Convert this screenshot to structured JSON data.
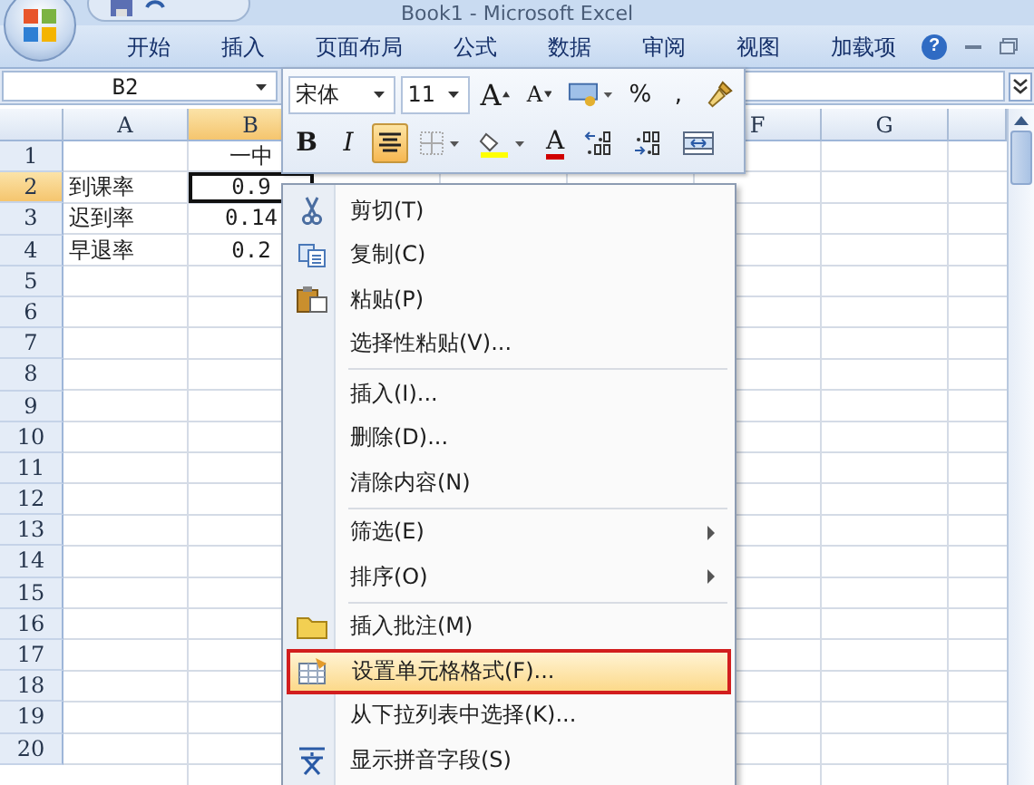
{
  "window": {
    "title": "Book1 - Microsoft Excel"
  },
  "ribbon_tabs": [
    {
      "label": "开始",
      "selected": false
    },
    {
      "label": "插入",
      "selected": false
    },
    {
      "label": "页面布局",
      "selected": false
    },
    {
      "label": "公式",
      "selected": false
    },
    {
      "label": "数据",
      "selected": false
    },
    {
      "label": "审阅",
      "selected": false
    },
    {
      "label": "视图",
      "selected": false
    },
    {
      "label": "加载项",
      "selected": false
    }
  ],
  "help_button": {
    "label": "?"
  },
  "formula_bar": {
    "name_box": "B2"
  },
  "sheet": {
    "columns": {
      "a": {
        "label": "A",
        "selected": false
      },
      "b": {
        "label": "B",
        "selected": true
      },
      "f": {
        "label": "F",
        "selected": false
      },
      "g": {
        "label": "G",
        "selected": false
      }
    },
    "rows": [
      {
        "label": "1",
        "selected": false,
        "cells": {
          "b": {
            "text": "一中",
            "active": false
          }
        }
      },
      {
        "label": "2",
        "selected": true,
        "cells": {
          "a": {
            "text": "到课率",
            "active": false
          },
          "b": {
            "text": "0.9",
            "active": true
          }
        }
      },
      {
        "label": "3",
        "selected": false,
        "cells": {
          "a": {
            "text": "迟到率",
            "active": false
          },
          "b": {
            "text": "0.14",
            "active": false
          }
        }
      },
      {
        "label": "4",
        "selected": false,
        "cells": {
          "a": {
            "text": "早退率",
            "active": false
          },
          "b": {
            "text": "0.2",
            "active": false
          }
        }
      },
      {
        "label": "5",
        "selected": false
      },
      {
        "label": "6",
        "selected": false
      },
      {
        "label": "7",
        "selected": false
      },
      {
        "label": "8",
        "selected": false
      },
      {
        "label": "9",
        "selected": false
      },
      {
        "label": "10",
        "selected": false
      },
      {
        "label": "11",
        "selected": false
      },
      {
        "label": "12",
        "selected": false
      },
      {
        "label": "13",
        "selected": false
      },
      {
        "label": "14",
        "selected": false
      },
      {
        "label": "15",
        "selected": false
      },
      {
        "label": "16",
        "selected": false
      },
      {
        "label": "17",
        "selected": false
      },
      {
        "label": "18",
        "selected": false
      },
      {
        "label": "19",
        "selected": false
      },
      {
        "label": "20",
        "selected": false
      }
    ]
  },
  "mini_toolbar": {
    "rows": [
      [
        {
          "kind": "font",
          "value": "宋体"
        },
        {
          "kind": "size",
          "value": "11"
        },
        {
          "kind": "grow",
          "label": "A",
          "pressed": false
        },
        {
          "kind": "shrink",
          "label": "A",
          "pressed": false
        },
        {
          "kind": "numfmt",
          "pressed": false
        },
        {
          "kind": "text",
          "label": "%",
          "pressed": false
        },
        {
          "kind": "text",
          "label": ",",
          "pressed": false
        },
        {
          "kind": "painter",
          "pressed": false
        }
      ],
      [
        {
          "kind": "bold",
          "label": "B",
          "pressed": false
        },
        {
          "kind": "italic",
          "label": "I",
          "pressed": false
        },
        {
          "kind": "center",
          "pressed": true
        },
        {
          "kind": "borders",
          "pressed": false
        },
        {
          "kind": "fill",
          "pressed": false
        },
        {
          "kind": "fontcolor",
          "label": "A",
          "pressed": false
        },
        {
          "kind": "incdec",
          "pressed": false
        },
        {
          "kind": "decdec",
          "pressed": false
        },
        {
          "kind": "merge",
          "pressed": false
        }
      ]
    ]
  },
  "context_menu": {
    "groups": [
      [
        {
          "label": "剪切(T)",
          "kind": "cut",
          "submenu": false,
          "selected": false
        },
        {
          "label": "复制(C)",
          "kind": "copy",
          "submenu": false,
          "selected": false
        },
        {
          "label": "粘贴(P)",
          "kind": "paste",
          "submenu": false,
          "selected": false
        },
        {
          "label": "选择性粘贴(V)...",
          "kind": "plain",
          "submenu": false,
          "selected": false
        }
      ],
      [
        {
          "label": "插入(I)...",
          "kind": "plain",
          "submenu": false,
          "selected": false
        },
        {
          "label": "删除(D)...",
          "kind": "plain",
          "submenu": false,
          "selected": false
        },
        {
          "label": "清除内容(N)",
          "kind": "plain",
          "submenu": false,
          "selected": false
        }
      ],
      [
        {
          "label": "筛选(E)",
          "kind": "plain",
          "submenu": true,
          "selected": false
        },
        {
          "label": "排序(O)",
          "kind": "plain",
          "submenu": true,
          "selected": false
        }
      ],
      [
        {
          "label": "插入批注(M)",
          "kind": "comment",
          "submenu": false,
          "selected": false
        },
        {
          "label": "设置单元格格式(F)...",
          "kind": "format",
          "submenu": false,
          "selected": true
        },
        {
          "label": "从下拉列表中选择(K)...",
          "kind": "plain",
          "submenu": false,
          "selected": false
        },
        {
          "label": "显示拼音字段(S)",
          "kind": "phonetic",
          "submenu": false,
          "selected": false
        }
      ]
    ]
  }
}
